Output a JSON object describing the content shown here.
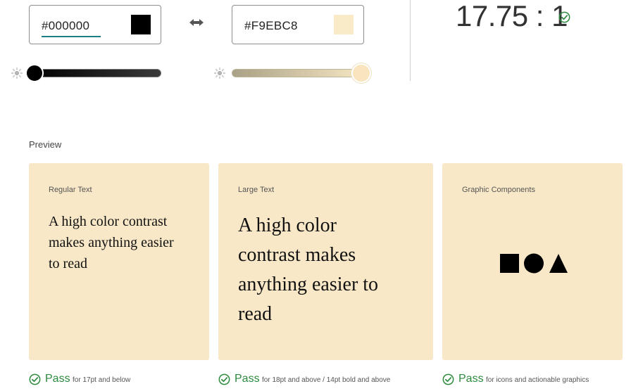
{
  "foreground": {
    "hex": "#000000",
    "swatch_color": "#000000"
  },
  "background": {
    "hex": "#F9EBC8",
    "swatch_color": "#F9EBC8"
  },
  "contrast": {
    "ratio": "17.75 : 1"
  },
  "preview": {
    "label": "Preview",
    "card_color": "#F8E8C7",
    "regular": {
      "title": "Regular Text",
      "text": "A high color contrast makes anything easier to read"
    },
    "large": {
      "title": "Large Text",
      "text": "A high color contrast makes anything easier to read"
    },
    "graphic": {
      "title": "Graphic Components"
    }
  },
  "results": [
    {
      "status": "Pass",
      "desc": "for 17pt and below"
    },
    {
      "status": "Pass",
      "desc": "for 18pt and above / 14pt bold and above"
    },
    {
      "status": "Pass",
      "desc": "for icons and actionable graphics"
    }
  ],
  "colors": {
    "pass": "#2d8a3e",
    "accent": "#1b7f86"
  },
  "icons": [
    "swap-horizontal-icon",
    "brightness-icon",
    "check-circle-icon",
    "square-icon",
    "circle-icon",
    "triangle-icon"
  ]
}
